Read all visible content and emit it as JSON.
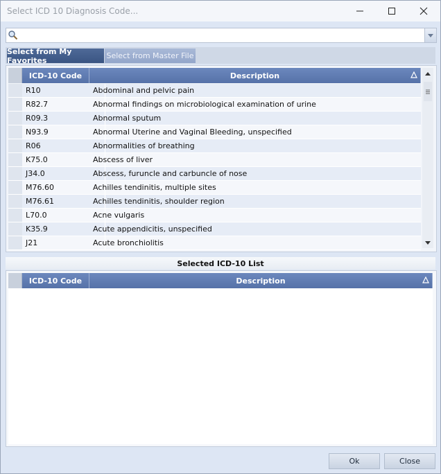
{
  "window": {
    "title": "Select ICD 10 Diagnosis Code...",
    "controls": {
      "minimize": "—",
      "maximize": "☐",
      "close": "✕"
    }
  },
  "search": {
    "value": "",
    "placeholder": ""
  },
  "tabs": [
    {
      "label": "Select from My Favorites",
      "active": true
    },
    {
      "label": "Select from Master File",
      "active": false
    }
  ],
  "favorites_grid": {
    "columns": [
      "ICD-10 Code",
      "Description"
    ],
    "rows": [
      {
        "code": "R10",
        "description": "Abdominal and pelvic pain"
      },
      {
        "code": "R82.7",
        "description": "Abnormal findings on microbiological examination of urine"
      },
      {
        "code": "R09.3",
        "description": "Abnormal sputum"
      },
      {
        "code": "N93.9",
        "description": "Abnormal Uterine and Vaginal Bleeding, unspecified"
      },
      {
        "code": "R06",
        "description": "Abnormalities of breathing"
      },
      {
        "code": "K75.0",
        "description": "Abscess of liver"
      },
      {
        "code": "J34.0",
        "description": "Abscess, furuncle and carbuncle of nose"
      },
      {
        "code": "M76.60",
        "description": "Achilles tendinitis, multiple sites"
      },
      {
        "code": "M76.61",
        "description": "Achilles tendinitis, shoulder region"
      },
      {
        "code": "L70.0",
        "description": "Acne vulgaris"
      },
      {
        "code": "K35.9",
        "description": "Acute appendicitis, unspecified"
      },
      {
        "code": "J21",
        "description": "Acute bronchiolitis"
      }
    ]
  },
  "selected_list": {
    "title": "Selected ICD-10 List",
    "columns": [
      "ICD-10 Code",
      "Description"
    ]
  },
  "footer": {
    "ok_label": "Ok",
    "close_label": "Close"
  },
  "colors": {
    "accent": "#5672a8",
    "active_tab": "#3a5482",
    "inactive_tab": "#93a6ca"
  }
}
